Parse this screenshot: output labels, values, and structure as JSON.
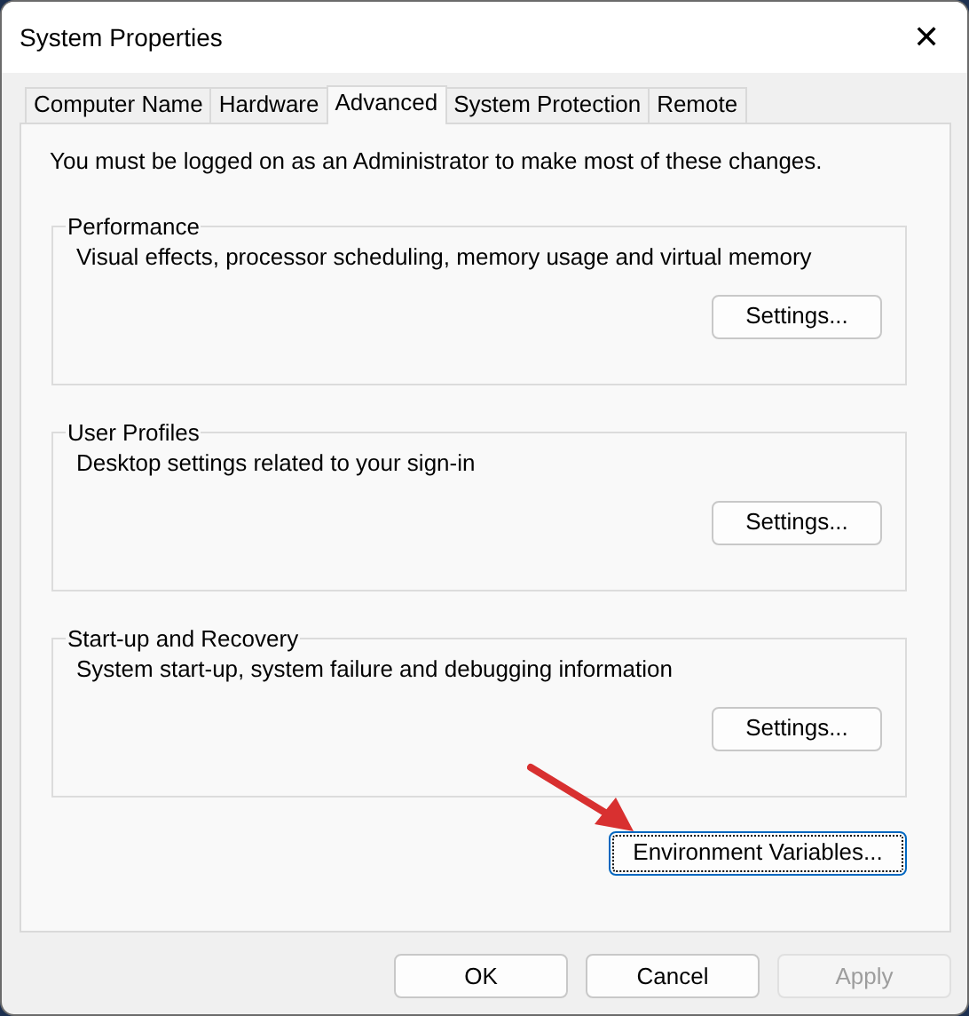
{
  "window": {
    "title": "System Properties",
    "close": "✕"
  },
  "tabs": [
    {
      "label": "Computer Name",
      "selected": false
    },
    {
      "label": "Hardware",
      "selected": false
    },
    {
      "label": "Advanced",
      "selected": true
    },
    {
      "label": "System Protection",
      "selected": false
    },
    {
      "label": "Remote",
      "selected": false
    }
  ],
  "notice": "You must be logged on as an Administrator to make most of these changes.",
  "groups": [
    {
      "title": "Performance",
      "description": "Visual effects, processor scheduling, memory usage and virtual memory",
      "button": "Settings..."
    },
    {
      "title": "User Profiles",
      "description": "Desktop settings related to your sign-in",
      "button": "Settings..."
    },
    {
      "title": "Start-up and Recovery",
      "description": "System start-up, system failure and debugging information",
      "button": "Settings..."
    }
  ],
  "environment_button": {
    "label": "Environment Variables...",
    "focused": true
  },
  "buttons": [
    {
      "label": "OK",
      "disabled": false
    },
    {
      "label": "Cancel",
      "disabled": false
    },
    {
      "label": "Apply",
      "disabled": true
    }
  ]
}
